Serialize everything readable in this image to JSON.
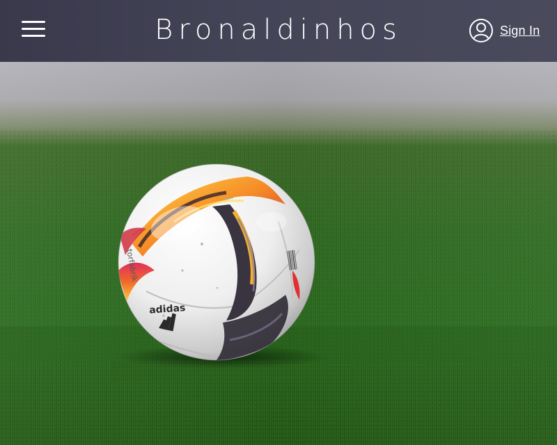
{
  "header": {
    "title": "Bronaldinhos",
    "menu_icon": "hamburger-menu-icon",
    "signin_icon": "user-circle-icon",
    "signin_label": "Sign In",
    "background": "#43425A"
  },
  "hero": {
    "ball_brand_text": "adidas",
    "ball_model_text": "torfabrik"
  }
}
